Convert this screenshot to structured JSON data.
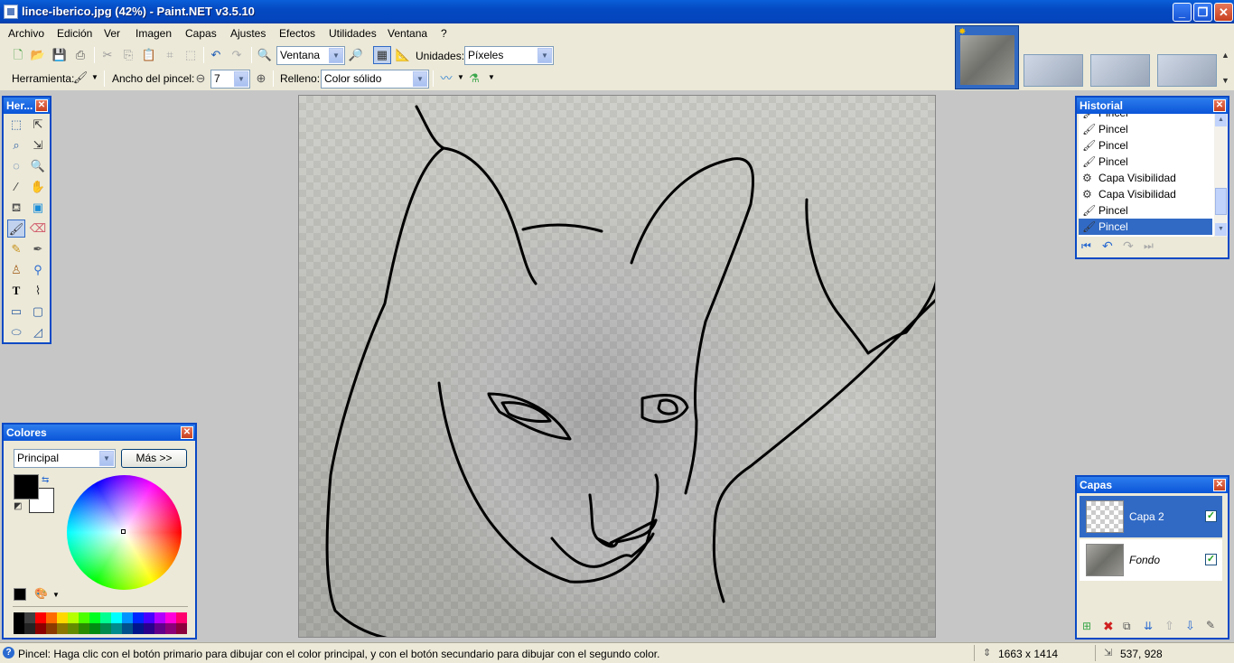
{
  "window": {
    "title": "lince-iberico.jpg (42%) - Paint.NET v3.5.10"
  },
  "menu": [
    "Archivo",
    "Edición",
    "Ver",
    "Imagen",
    "Capas",
    "Ajustes",
    "Efectos",
    "Utilidades",
    "Ventana",
    "?"
  ],
  "toolbar": {
    "zoom_value": "Ventana",
    "units_label": "Unidades:",
    "units_value": "Píxeles",
    "tool_label": "Herramienta:",
    "brush_width_label": "Ancho del pincel:",
    "brush_width_value": "7",
    "fill_label": "Relleno:",
    "fill_value": "Color sólido"
  },
  "tools_panel": {
    "title": "Her..."
  },
  "colors_panel": {
    "title": "Colores",
    "mode_value": "Principal",
    "more_button": "Más >>",
    "primary_color": "#000000",
    "secondary_color": "#ffffff"
  },
  "history_panel": {
    "title": "Historial",
    "items": [
      "Pincel",
      "Pincel",
      "Pincel",
      "Pincel",
      "Capa Visibilidad",
      "Capa Visibilidad",
      "Pincel",
      "Pincel"
    ],
    "selected_index": 7
  },
  "layers_panel": {
    "title": "Capas",
    "layers": [
      {
        "name": "Capa 2",
        "visible": true
      },
      {
        "name": "Fondo",
        "visible": true
      }
    ],
    "selected_index": 0
  },
  "statusbar": {
    "hint": "Pincel: Haga clic con el botón primario para dibujar con el color principal, y con el botón secundario para dibujar con el segundo color.",
    "image_size": "1663 x 1414",
    "cursor_position": "537, 928"
  },
  "palette": [
    "#000000",
    "#404040",
    "#ff0000",
    "#ff6a00",
    "#ffd800",
    "#b6ff00",
    "#4cff00",
    "#00ff21",
    "#00ff90",
    "#00ffff",
    "#0094ff",
    "#0026ff",
    "#4800ff",
    "#b200ff",
    "#ff00dc",
    "#ff006e"
  ]
}
